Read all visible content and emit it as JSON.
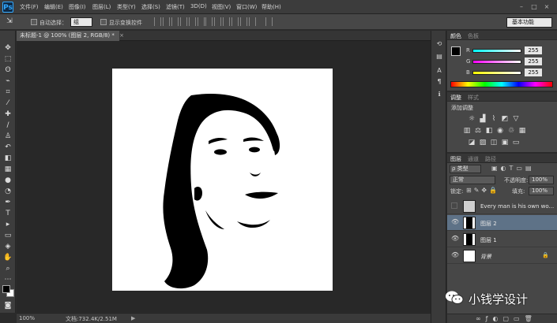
{
  "app": {
    "logo": "Ps"
  },
  "menu": [
    "文件(F)",
    "编辑(E)",
    "图像(I)",
    "图层(L)",
    "类型(Y)",
    "选择(S)",
    "滤镜(T)",
    "3D(D)",
    "视图(V)",
    "窗口(W)",
    "帮助(H)"
  ],
  "window_controls": [
    "–",
    "□",
    "×"
  ],
  "options": {
    "auto_select_label": "自动选择：",
    "auto_select_value": "组",
    "show_transform_label": "显示变换控件",
    "workspace": "基本功能"
  },
  "document": {
    "tab_title": "未标题-1 @ 100% (图层 2, RGB/8) *",
    "tab_close": "×"
  },
  "status": {
    "zoom": "100%",
    "doc_size": "文档:732.4K/2.51M"
  },
  "color_panel": {
    "tabs": [
      "颜色",
      "色板"
    ],
    "channels": [
      {
        "label": "R",
        "value": "255"
      },
      {
        "label": "G",
        "value": "255"
      },
      {
        "label": "B",
        "value": "255"
      }
    ]
  },
  "adjustments_panel": {
    "tabs": [
      "调整",
      "样式"
    ],
    "title": "添加调整"
  },
  "layers_panel": {
    "tabs": [
      "图层",
      "通道",
      "路径"
    ],
    "filter_label": "ρ 类型",
    "blend_mode": "正常",
    "opacity_label": "不透明度:",
    "opacity_value": "100%",
    "lock_label": "锁定:",
    "fill_label": "填充:",
    "fill_value": "100%",
    "layers": [
      {
        "name": "Every man is his own wo...",
        "visible": false,
        "selected": false
      },
      {
        "name": "图层 2",
        "visible": true,
        "selected": true
      },
      {
        "name": "图层 1",
        "visible": true,
        "selected": false
      },
      {
        "name": "背景",
        "visible": true,
        "selected": false
      }
    ]
  },
  "watermark": {
    "text": "小钱学设计"
  },
  "colors": {
    "selected_layer": "#5e7287",
    "ui_bg": "#474747",
    "canvas_bg": "#282828"
  }
}
